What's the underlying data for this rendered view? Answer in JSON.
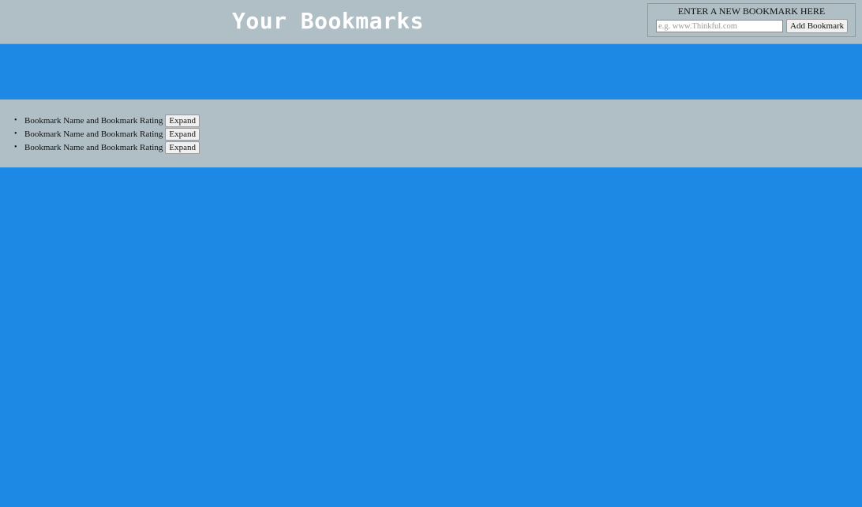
{
  "header": {
    "title": "Your Bookmarks",
    "form": {
      "legend": "ENTER A NEW BOOKMARK HERE",
      "input_placeholder": "e.g. www.Thinkful.com",
      "input_value": "",
      "submit_label": "Add Bookmark"
    }
  },
  "bookmarks": {
    "items": [
      {
        "label": "Bookmark Name and Bookmark Rating",
        "button": "Expand"
      },
      {
        "label": "Bookmark Name and Bookmark Rating",
        "button": "Expand"
      },
      {
        "label": "Bookmark Name and Bookmark Rating",
        "button": "Expand"
      }
    ]
  },
  "colors": {
    "page_background": "#1e88e5",
    "panel_background": "#b0bec5",
    "title_text": "#ffffff"
  }
}
